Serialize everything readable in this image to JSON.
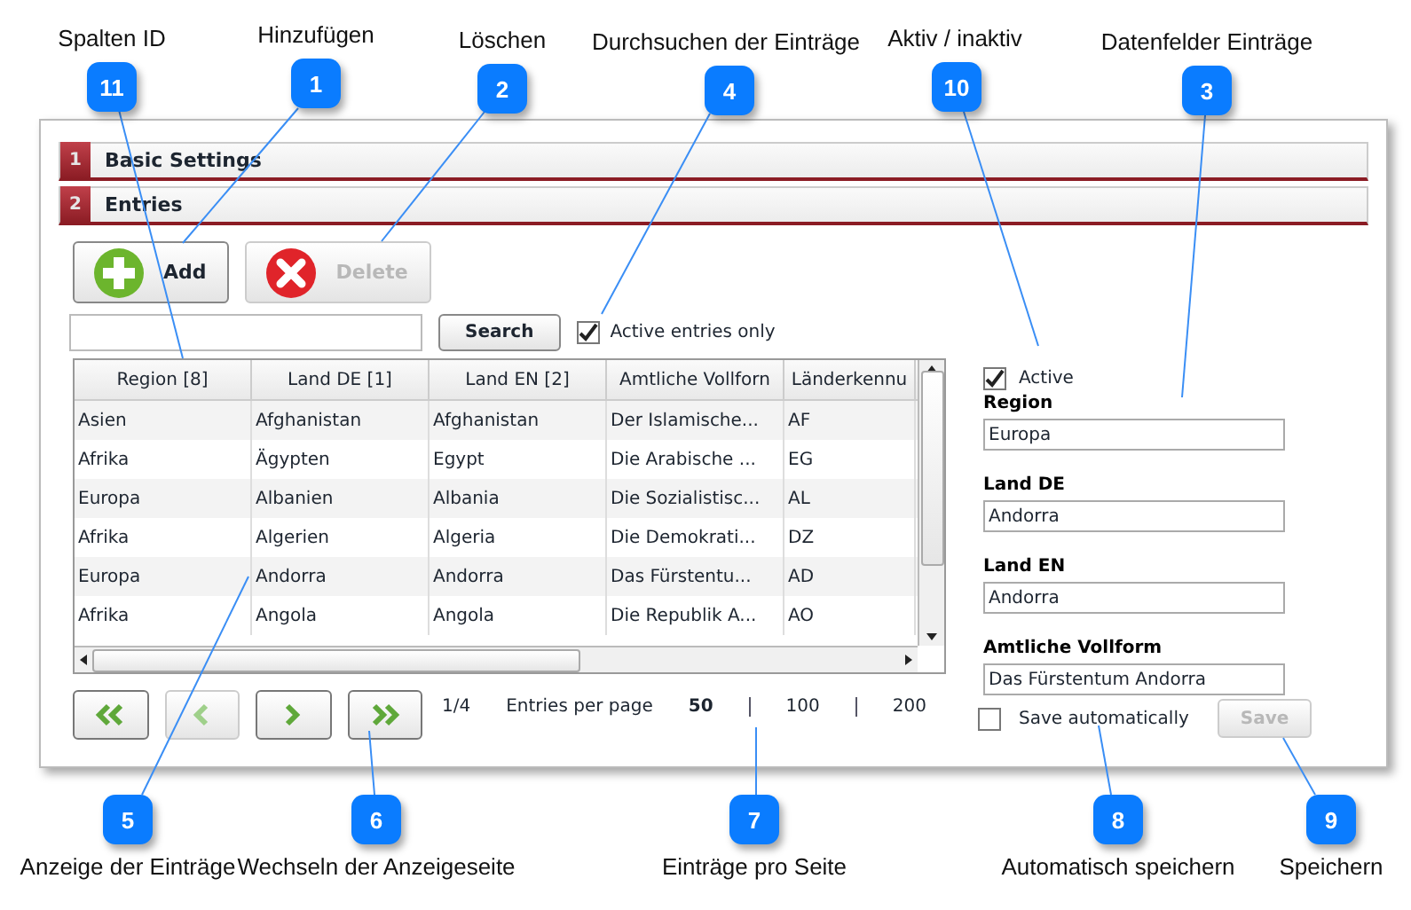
{
  "callouts": [
    {
      "number": "11",
      "label": "Spalten ID"
    },
    {
      "number": "1",
      "label": "Hinzufügen"
    },
    {
      "number": "2",
      "label": "Löschen"
    },
    {
      "number": "4",
      "label": "Durchsuchen der Einträge"
    },
    {
      "number": "10",
      "label": "Aktiv / inaktiv"
    },
    {
      "number": "3",
      "label": "Datenfelder Einträge"
    },
    {
      "number": "5",
      "label": "Anzeige der Einträge"
    },
    {
      "number": "6",
      "label": "Wechseln der Anzeigeseite"
    },
    {
      "number": "7",
      "label": "Einträge pro Seite"
    },
    {
      "number": "8",
      "label": "Automatisch speichern"
    },
    {
      "number": "9",
      "label": "Speichern"
    }
  ],
  "sections": [
    {
      "number": "1",
      "title": "Basic Settings"
    },
    {
      "number": "2",
      "title": "Entries"
    }
  ],
  "toolbar": {
    "buttons": [
      {
        "kind": "add",
        "label": "Add",
        "disabled": false
      },
      {
        "kind": "delete",
        "label": "Delete",
        "disabled": true
      }
    ]
  },
  "search": {
    "button": "Search",
    "active_only": {
      "label": "Active entries only",
      "checked": true
    }
  },
  "table": {
    "columns": [
      "Region [8]",
      "Land DE [1]",
      "Land EN [2]",
      "Amtliche Vollforn",
      "Länderkennu"
    ],
    "rows": [
      [
        "Asien",
        "Afghanistan",
        "Afghanistan",
        "Der Islamische...",
        "AF"
      ],
      [
        "Afrika",
        "Ägypten",
        "Egypt",
        "Die Arabische ...",
        "EG"
      ],
      [
        "Europa",
        "Albanien",
        "Albania",
        "Die Sozialistisc...",
        "AL"
      ],
      [
        "Afrika",
        "Algerien",
        "Algeria",
        "Die Demokrati...",
        "DZ"
      ],
      [
        "Europa",
        "Andorra",
        "Andorra",
        "Das Fürstentu...",
        "AD"
      ],
      [
        "Afrika",
        "Angola",
        "Angola",
        "Die Republik A...",
        "AO"
      ]
    ]
  },
  "pager": {
    "buttons": [
      {
        "kind": "first",
        "disabled": false
      },
      {
        "kind": "prev",
        "disabled": true
      },
      {
        "kind": "next",
        "disabled": false
      },
      {
        "kind": "last",
        "disabled": false
      }
    ],
    "page": "1/4",
    "per_page_label": "Entries per page",
    "per_page": [
      {
        "label": "50",
        "selected": true
      },
      {
        "label": "100",
        "selected": false
      },
      {
        "label": "200",
        "selected": false
      }
    ]
  },
  "detail": {
    "active": {
      "label": "Active",
      "checked": true
    },
    "fields": [
      {
        "label": "Region",
        "value": "Europa"
      },
      {
        "label": "Land DE",
        "value": "Andorra"
      },
      {
        "label": "Land EN",
        "value": "Andorra"
      },
      {
        "label": "Amtliche Vollform",
        "value": "Das Fürstentum Andorra"
      }
    ]
  },
  "save_automatically": {
    "label": "Save automatically",
    "checked": false
  },
  "save_button": {
    "label": "Save",
    "disabled": true
  }
}
